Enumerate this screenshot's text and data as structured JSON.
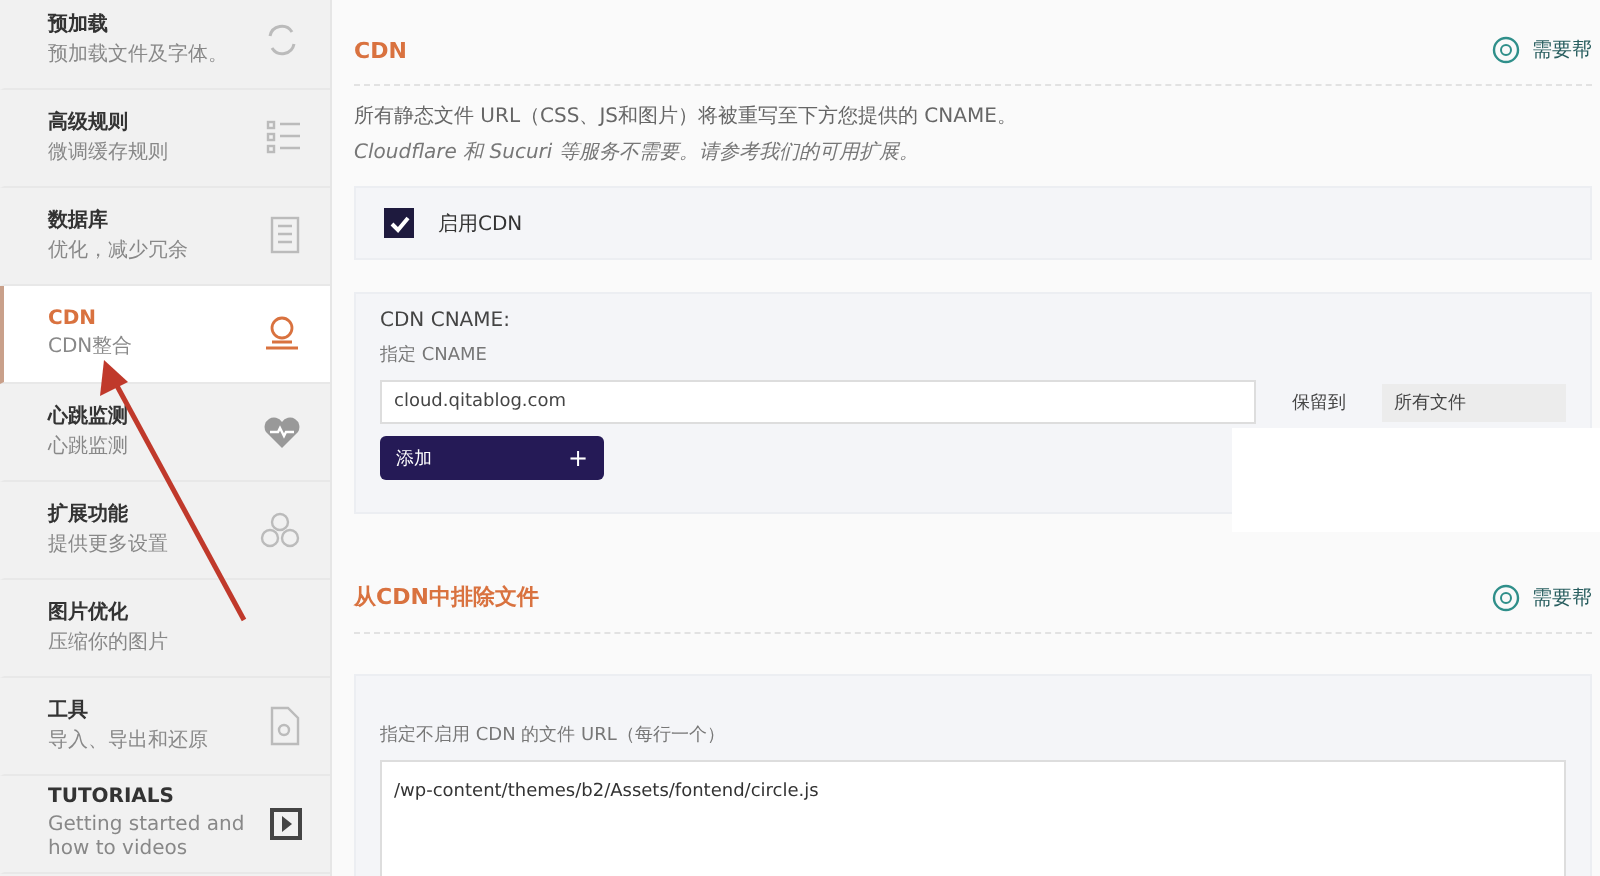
{
  "sidebar": {
    "items": [
      {
        "title": "预加载",
        "subtitle": "预加载文件及字体。",
        "selected": false
      },
      {
        "title": "高级规则",
        "subtitle": "微调缓存规则",
        "selected": false
      },
      {
        "title": "数据库",
        "subtitle": "优化，减少冗余",
        "selected": false
      },
      {
        "title": "CDN",
        "subtitle": "CDN整合",
        "selected": true
      },
      {
        "title": "心跳监测",
        "subtitle": "心跳监测",
        "selected": false
      },
      {
        "title": "扩展功能",
        "subtitle": "提供更多设置",
        "selected": false
      },
      {
        "title": "图片优化",
        "subtitle": "压缩你的图片",
        "selected": false
      },
      {
        "title": "工具",
        "subtitle": "导入、导出和还原",
        "selected": false
      },
      {
        "title": "TUTORIALS",
        "subtitle": "Getting started and how to videos",
        "selected": false
      }
    ]
  },
  "cdn_section": {
    "title": "CDN",
    "help": "需要帮",
    "description": "所有静态文件 URL（CSS、JS和图片）将被重写至下方您提供的 CNAME。",
    "note": "Cloudflare 和 Sucuri 等服务不需要。请参考我们的可用扩展。",
    "enable_cdn": {
      "label": "启用CDN",
      "checked": true
    },
    "cname": {
      "heading": "CDN CNAME:",
      "label": "指定 CNAME",
      "value": "cloud.qitablog.com",
      "reserved_label": "保留到",
      "reserved_value": "所有文件",
      "add_button": "添加",
      "add_icon": "+"
    }
  },
  "exclude_section": {
    "title": "从CDN中排除文件",
    "help": "需要帮",
    "label": "指定不启用 CDN 的文件 URL（每行一个）",
    "value": "/wp-content/themes/b2/Assets/fontend/circle.js"
  }
}
